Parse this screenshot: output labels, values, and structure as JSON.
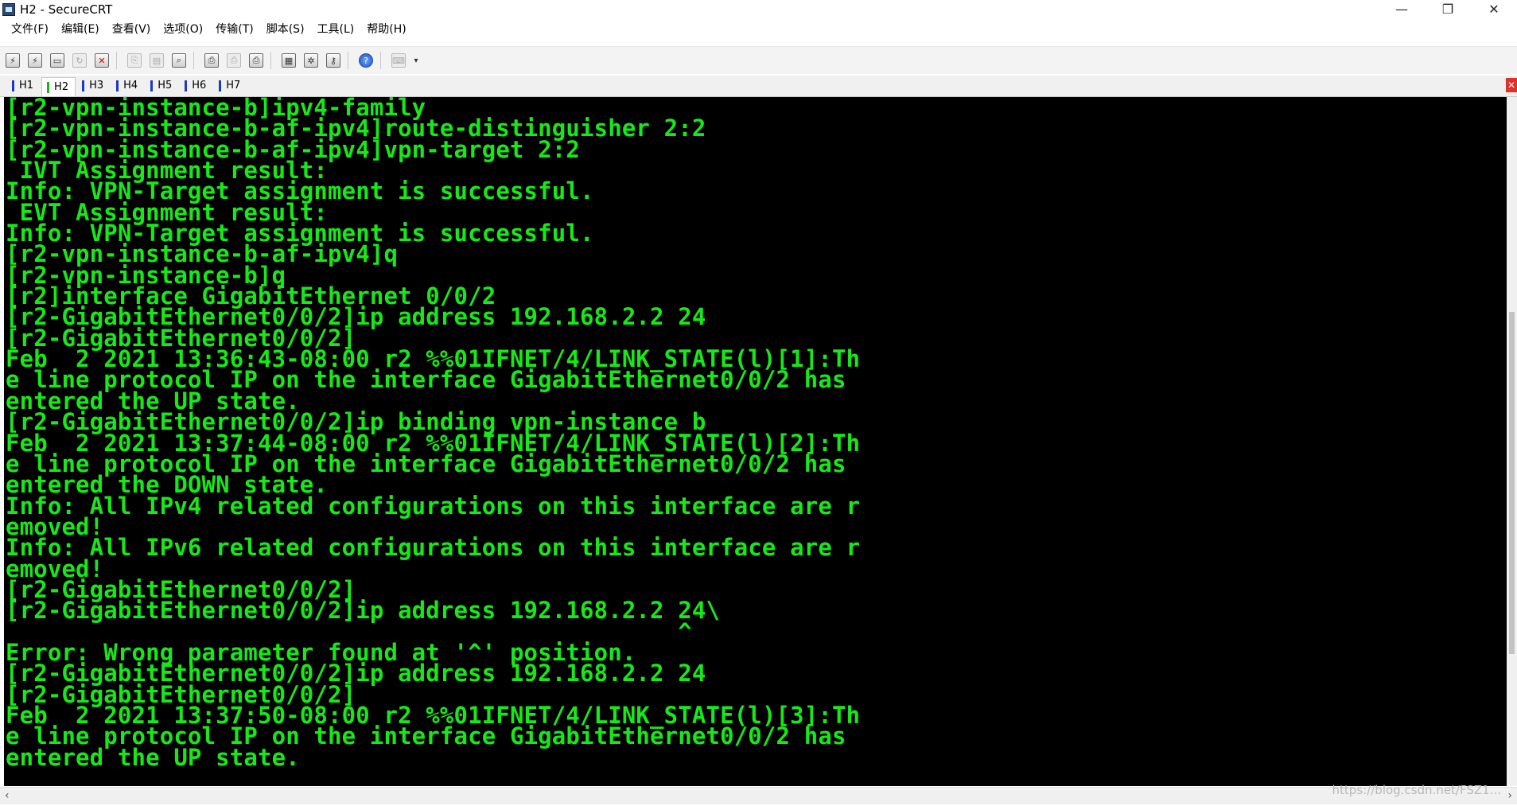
{
  "window": {
    "title": "H2 - SecureCRT",
    "minimize": "—",
    "restore": "❐",
    "close": "✕"
  },
  "menu": [
    "文件(F)",
    "编辑(E)",
    "查看(V)",
    "选项(O)",
    "传输(T)",
    "脚本(S)",
    "工具(L)",
    "帮助(H)"
  ],
  "toolbar_icons": [
    "connect-icon",
    "quick-connect-icon",
    "connect-tab-icon",
    "reconnect-icon",
    "disconnect-icon",
    "copy-icon",
    "paste-icon",
    "find-icon",
    "print-icon",
    "print-selection-icon",
    "print-setup-icon",
    "session-options-icon",
    "global-options-icon",
    "key-icon",
    "help-icon",
    "keymap-icon"
  ],
  "tabs": [
    {
      "label": "H1",
      "active": false
    },
    {
      "label": "H2",
      "active": true
    },
    {
      "label": "H3",
      "active": false
    },
    {
      "label": "H4",
      "active": false
    },
    {
      "label": "H5",
      "active": false
    },
    {
      "label": "H6",
      "active": false
    },
    {
      "label": "H7",
      "active": false
    }
  ],
  "terminal": {
    "text_color": "#17e817",
    "background": "#000000",
    "lines": [
      "[r2-vpn-instance-b]ipv4-family",
      "[r2-vpn-instance-b-af-ipv4]route-distinguisher 2:2",
      "[r2-vpn-instance-b-af-ipv4]vpn-target 2:2",
      " IVT Assignment result:",
      "Info: VPN-Target assignment is successful.",
      " EVT Assignment result:",
      "Info: VPN-Target assignment is successful.",
      "[r2-vpn-instance-b-af-ipv4]q",
      "[r2-vpn-instance-b]q",
      "[r2]interface GigabitEthernet 0/0/2",
      "[r2-GigabitEthernet0/0/2]ip address 192.168.2.2 24",
      "[r2-GigabitEthernet0/0/2]",
      "Feb  2 2021 13:36:43-08:00 r2 %%01IFNET/4/LINK_STATE(l)[1]:Th",
      "e line protocol IP on the interface GigabitEthernet0/0/2 has",
      "entered the UP state.",
      "[r2-GigabitEthernet0/0/2]ip binding vpn-instance b",
      "Feb  2 2021 13:37:44-08:00 r2 %%01IFNET/4/LINK_STATE(l)[2]:Th",
      "e line protocol IP on the interface GigabitEthernet0/0/2 has",
      "entered the DOWN state.",
      "Info: All IPv4 related configurations on this interface are r",
      "emoved!",
      "Info: All IPv6 related configurations on this interface are r",
      "emoved!",
      "[r2-GigabitEthernet0/0/2]",
      "[r2-GigabitEthernet0/0/2]ip address 192.168.2.2 24\\",
      "                                                ^",
      "Error: Wrong parameter found at '^' position.",
      "[r2-GigabitEthernet0/0/2]ip address 192.168.2.2 24",
      "[r2-GigabitEthernet0/0/2]",
      "Feb  2 2021 13:37:50-08:00 r2 %%01IFNET/4/LINK_STATE(l)[3]:Th",
      "e line protocol IP on the interface GigabitEthernet0/0/2 has",
      "entered the UP state."
    ]
  },
  "watermark": "https://blog.csdn.net/FSZ1..."
}
